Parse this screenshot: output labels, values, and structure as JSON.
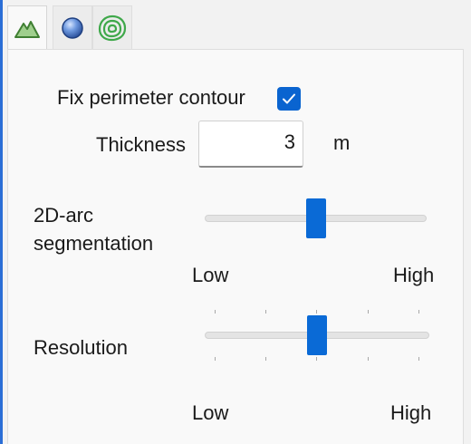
{
  "tabs": [
    {
      "icon": "mountain-icon",
      "active": true
    },
    {
      "icon": "sphere-icon",
      "active": false
    },
    {
      "icon": "contour-rings-icon",
      "active": false
    }
  ],
  "fix_perimeter": {
    "label": "Fix perimeter contour",
    "checked": true
  },
  "thickness": {
    "label": "Thickness",
    "value": "3",
    "unit": "m"
  },
  "arc_segmentation": {
    "label_line1": "2D-arc",
    "label_line2": "segmentation",
    "low_label": "Low",
    "high_label": "High",
    "level": 0.5
  },
  "resolution": {
    "label": "Resolution",
    "low_label": "Low",
    "high_label": "High",
    "level": 0.5
  },
  "colors": {
    "accent": "#0a64d0",
    "mountain_icon": "#5a9a4a",
    "contour_icon": "#4caf50",
    "sphere_icon": "#4a78c8"
  }
}
